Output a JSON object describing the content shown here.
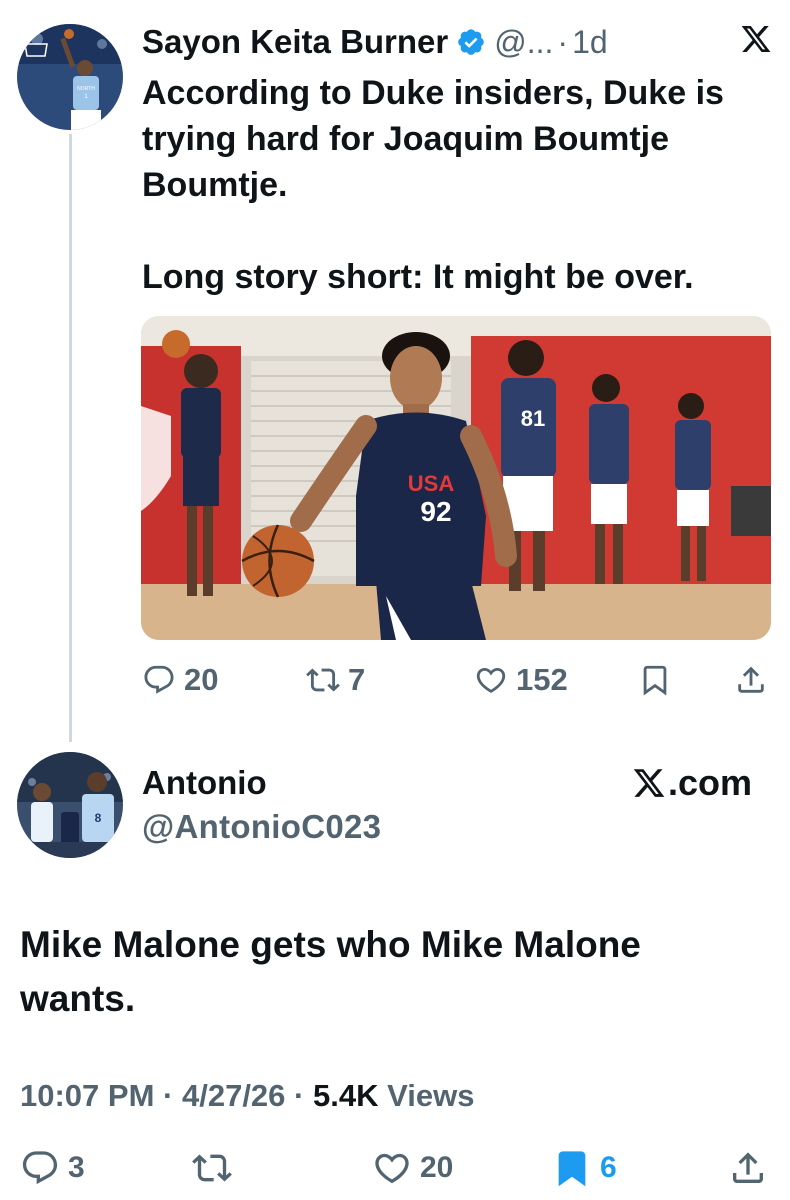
{
  "quoted_tweet": {
    "author_name": "Sayon Keita Burner",
    "handle": "@...",
    "separator": "·",
    "time": "1d",
    "text_paragraph_1": "According to Duke insiders, Duke is trying hard for Joaquim Boumtje Boumtje.",
    "text_paragraph_2": "Long story short: It might be over.",
    "media": {
      "jersey_text": "USA",
      "jersey_number": "92",
      "back_number": "81"
    },
    "actions": {
      "replies": "20",
      "reposts": "7",
      "likes": "152"
    }
  },
  "main_tweet": {
    "author_name": "Antonio",
    "handle": "@AntonioC023",
    "brand": ".com",
    "text": "Mike Malone gets who Mike Malone wants.",
    "time": "10:07 PM",
    "date": "4/27/26",
    "views_count": "5.4K",
    "views_label": "Views",
    "separator": "·",
    "actions": {
      "replies": "3",
      "likes": "20",
      "bookmarks": "6"
    }
  },
  "colors": {
    "text": "#0f1419",
    "secondary": "#536471",
    "accent": "#1d9bf0",
    "thread_line": "#cfd9de"
  },
  "icons": [
    "verified-badge-icon",
    "x-logo-icon",
    "reply-icon",
    "repost-icon",
    "like-icon",
    "bookmark-icon",
    "share-icon"
  ]
}
